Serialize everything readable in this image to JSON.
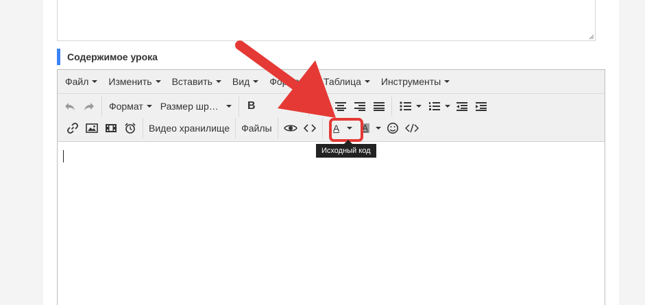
{
  "section": {
    "title": "Содержимое урока"
  },
  "menubar": {
    "items": [
      {
        "label": "Файл"
      },
      {
        "label": "Изменить"
      },
      {
        "label": "Вставить"
      },
      {
        "label": "Вид"
      },
      {
        "label": "Формат"
      },
      {
        "label": "Таблица"
      },
      {
        "label": "Инструменты"
      }
    ]
  },
  "toolbar": {
    "format_label": "Формат",
    "fontsize_label": "Размер шр…",
    "bold_label": "B",
    "video_storage_label": "Видео хранилище",
    "files_label": "Файлы",
    "text_color_letter": "A",
    "bg_color_letter": "A"
  },
  "tooltip": {
    "text": "Исходный код"
  },
  "colors": {
    "accent_bar": "#3b82f6",
    "annotation_red": "#e53935",
    "tooltip_bg": "#222222",
    "toolbar_bg": "#f0f0f0"
  },
  "icons": {
    "undo": "undo-icon",
    "redo": "redo-icon",
    "link": "link-icon",
    "image": "image-icon",
    "media": "media-icon",
    "alarm": "alarm-clock-icon",
    "preview": "eye-icon",
    "source_code": "source-code-icon",
    "emoticons": "smiley-icon",
    "code_sample": "code-sample-icon"
  }
}
